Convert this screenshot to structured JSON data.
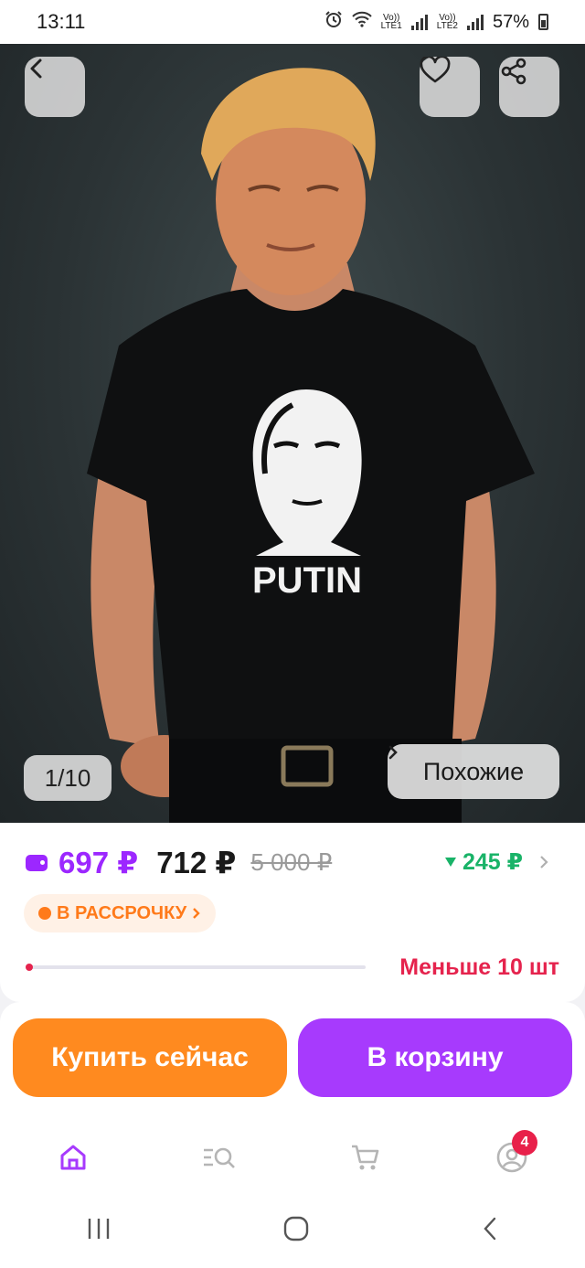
{
  "status_bar": {
    "time": "13:11",
    "sim1": "LTE1",
    "sim2": "LTE2",
    "volte": "Vo))",
    "battery": "57%",
    "icons": [
      "alarm-icon",
      "wifi-icon",
      "signal-icon",
      "battery-icon"
    ]
  },
  "gallery": {
    "counter": "1/10",
    "similar_label": "Похожие",
    "shirt_print": "PUTIN",
    "icons": [
      "back-icon",
      "heart-icon",
      "share-icon"
    ]
  },
  "price": {
    "wallet_price": "697 ₽",
    "regular_price": "712 ₽",
    "old_price": "5 000 ₽",
    "cashback": "245 ₽",
    "installment_label": "В РАССРОЧКУ",
    "stock_text": "Меньше 10 шт",
    "stock_fraction": 0.02
  },
  "actions": {
    "buy_now": "Купить сейчас",
    "add_to_cart": "В корзину"
  },
  "tabbar": {
    "icons": [
      "home-icon",
      "catalog-search-icon",
      "cart-icon",
      "profile-icon"
    ],
    "profile_badge": "4",
    "active": "home"
  },
  "colors": {
    "accent": "#a73afd",
    "price": "#9c27ff",
    "buy": "#ff8a1f",
    "cashback": "#19b368",
    "stock": "#e5234d"
  }
}
